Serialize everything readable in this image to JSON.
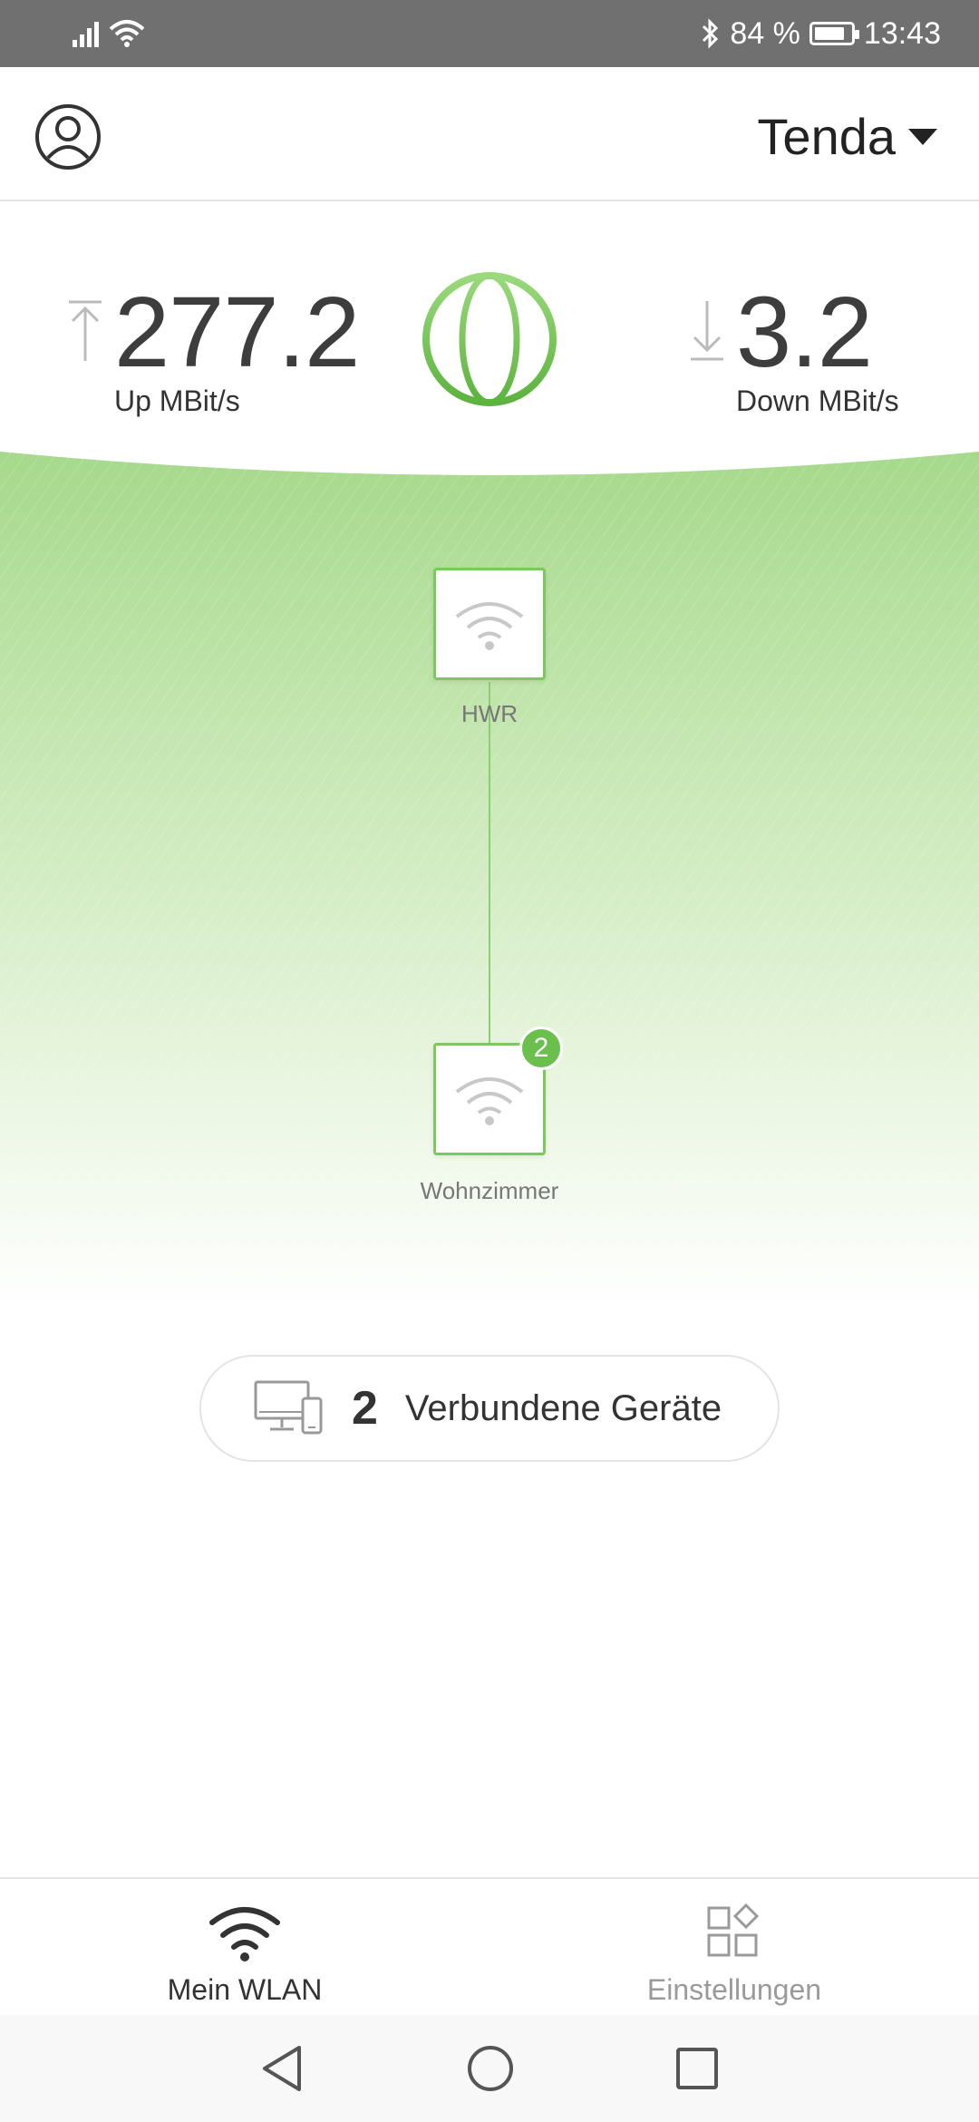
{
  "status_bar": {
    "battery": "84 %",
    "battery_level": 0.84,
    "time": "13:43"
  },
  "header": {
    "network_name": "Tenda"
  },
  "speed": {
    "up_value": "277.2",
    "up_label": "Up MBit/s",
    "down_value": "3.2",
    "down_label": "Down MBit/s"
  },
  "topology": {
    "nodes": [
      {
        "label": "HWR"
      },
      {
        "label": "Wohnzimmer",
        "badge": "2"
      }
    ]
  },
  "connected": {
    "count": "2",
    "label": "Verbundene Geräte"
  },
  "tabs": [
    {
      "label": "Mein WLAN",
      "icon": "wifi-icon",
      "active": true
    },
    {
      "label": "Einstellungen",
      "icon": "grid-settings-icon",
      "active": false
    }
  ],
  "colors": {
    "accent_green": "#6bbf4c",
    "status_bar": "#707070",
    "active_tab": "#333333",
    "inactive_tab": "#9a9a9a"
  }
}
